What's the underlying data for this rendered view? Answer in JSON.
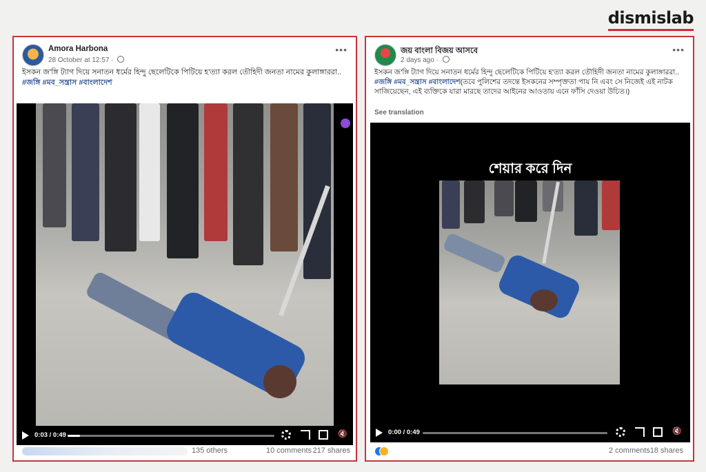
{
  "brand": {
    "name": "dismislab",
    "accent": "#d7263d"
  },
  "post_border_color": "#c8323f",
  "post1": {
    "author": "Amora Harbona",
    "time": "28 October at 12:57",
    "text": "ইসকন জ'ঙ্গি ট্যাগ দিয়ে সনাতন ধর্মের হিন্দু ছেলেটিকে পিটিয়ে হ'ত্যা করল তৌহিদী জনতা নামের কুলাঙ্গাররা..",
    "tags": "#জঙ্গি #মব_সন্ত্রাস #বাংলাদেশ",
    "video": {
      "time": "0:03 / 0:49",
      "progress": 0.06
    },
    "reactions_others": "135 others",
    "comments": "10 comments",
    "shares": "217 shares"
  },
  "post2": {
    "author": "জয় বাংলা বিজয় আসবে",
    "time": "2 days ago",
    "text": "ইসকন জ'ঙ্গি ট্যাগ দিয়ে সনাতন ধর্মের হিন্দু ছেলেটিকে পিটিয়ে হ'ত্যা করল তৌহিদী জনতা নামের কুলাঙ্গাররা..",
    "tags": "#জঙ্গি #মব_সন্ত্রাস #বাংলাদেশ",
    "extra": "(তবে পুলিশের তদন্তে ইসকনের সম্পৃক্ততা পায় নি এবং সে নিজেই এই নাটক সাজিয়েছেন, এই ব্যক্তিকে যারা মারছে তাদের আইনের আওতায় এনে ফাঁসি দেওয়া উচিত।)",
    "see_translation": "See translation",
    "video_overlay": "শেয়ার করে দিন",
    "video": {
      "time": "0:00 / 0:49",
      "progress": 0.0
    },
    "comments": "2 comments",
    "shares": "18 shares"
  }
}
